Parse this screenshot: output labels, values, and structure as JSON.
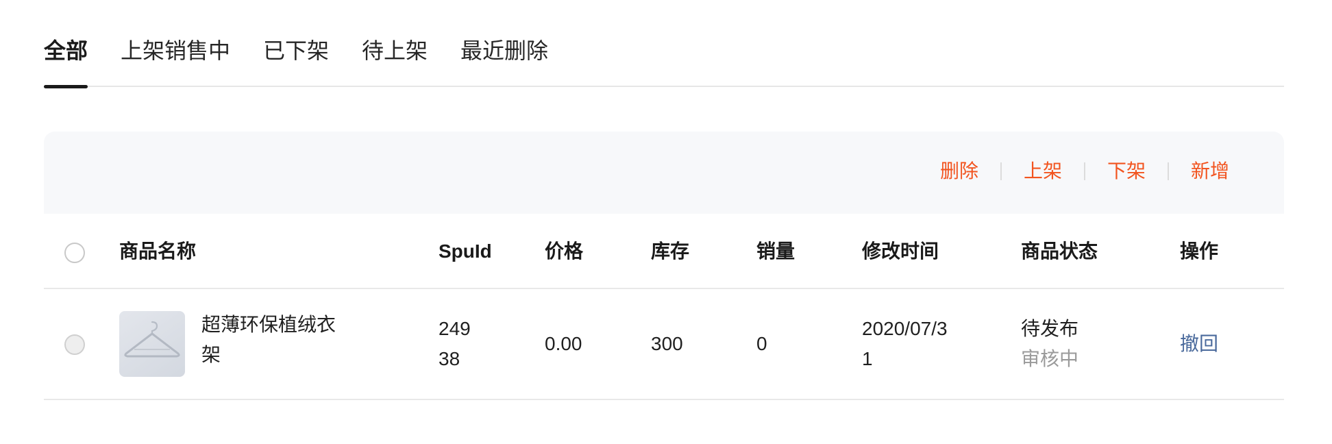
{
  "tabs": [
    {
      "label": "全部",
      "active": true
    },
    {
      "label": "上架销售中",
      "active": false
    },
    {
      "label": "已下架",
      "active": false
    },
    {
      "label": "待上架",
      "active": false
    },
    {
      "label": "最近删除",
      "active": false
    }
  ],
  "toolbar": {
    "delete_label": "删除",
    "shelve_label": "上架",
    "unshelve_label": "下架",
    "add_label": "新增",
    "accent_color": "#f2541f"
  },
  "table": {
    "headers": {
      "name": "商品名称",
      "spuid": "SpuId",
      "price": "价格",
      "stock": "库存",
      "sales": "销量",
      "modified": "修改时间",
      "status": "商品状态",
      "action": "操作"
    },
    "rows": [
      {
        "thumbnail_icon": "hanger-image",
        "name_line1": "超薄环保植绒衣",
        "name_line2": "架",
        "spuid_line1": "249",
        "spuid_line2": "38",
        "price": "0.00",
        "stock": "300",
        "sales": "0",
        "modified_line1": "2020/07/3",
        "modified_line2": "1",
        "status": "待发布",
        "status_sub": "审核中",
        "action": "撤回"
      }
    ]
  }
}
